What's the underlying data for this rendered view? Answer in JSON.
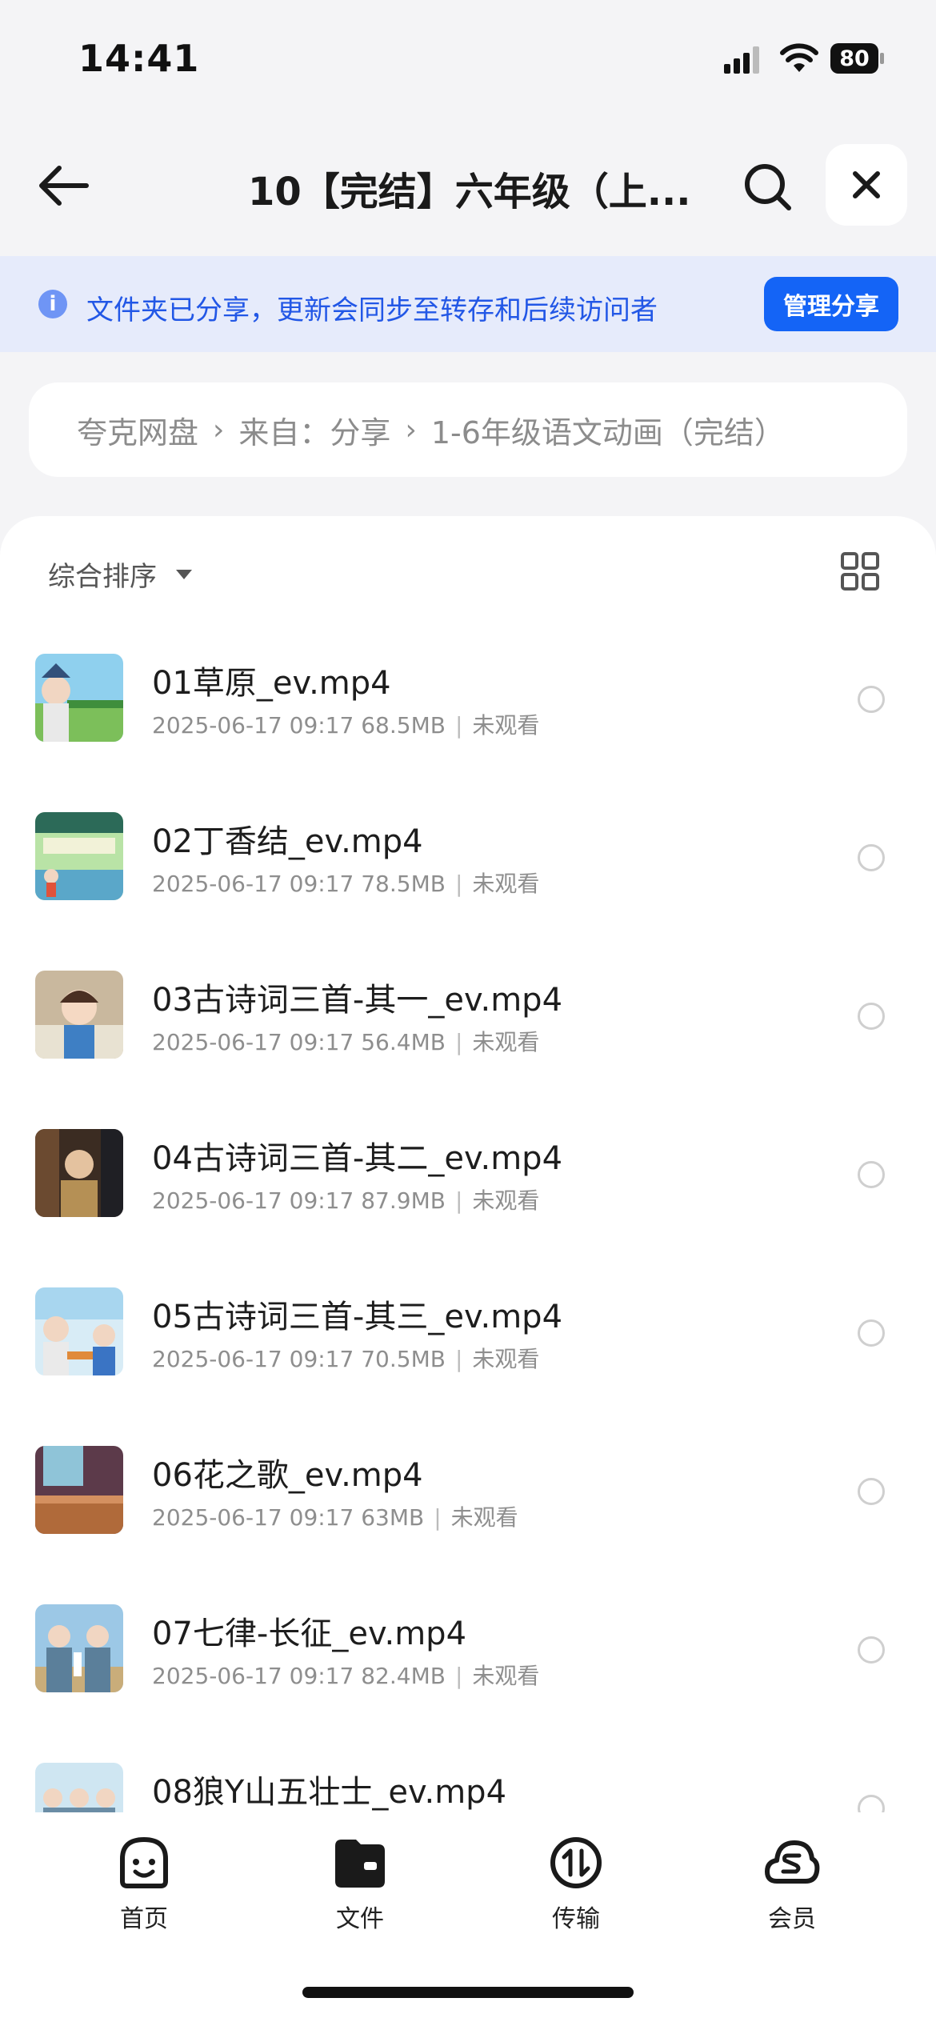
{
  "status_bar": {
    "time": "14:41",
    "battery": "80"
  },
  "nav": {
    "title": "10【完结】六年级（上..."
  },
  "banner": {
    "text": "文件夹已分享，更新会同步至转存和后续访问者",
    "button": "管理分享",
    "info_glyph": "i"
  },
  "breadcrumb": [
    "夸克网盘",
    "来自：分享",
    "1-6年级语文动画（完结）"
  ],
  "sort": {
    "label": "综合排序"
  },
  "files": [
    {
      "name": "01草原_ev.mp4",
      "date": "2025-06-17 09:17",
      "size": "68.5MB",
      "status": "未观看"
    },
    {
      "name": "02丁香结_ev.mp4",
      "date": "2025-06-17 09:17",
      "size": "78.5MB",
      "status": "未观看"
    },
    {
      "name": "03古诗词三首-其一_ev.mp4",
      "date": "2025-06-17 09:17",
      "size": "56.4MB",
      "status": "未观看"
    },
    {
      "name": "04古诗词三首-其二_ev.mp4",
      "date": "2025-06-17 09:17",
      "size": "87.9MB",
      "status": "未观看"
    },
    {
      "name": "05古诗词三首-其三_ev.mp4",
      "date": "2025-06-17 09:17",
      "size": "70.5MB",
      "status": "未观看"
    },
    {
      "name": "06花之歌_ev.mp4",
      "date": "2025-06-17 09:17",
      "size": "63MB",
      "status": "未观看"
    },
    {
      "name": "07七律-长征_ev.mp4",
      "date": "2025-06-17 09:17",
      "size": "82.4MB",
      "status": "未观看"
    },
    {
      "name": "08狼Y山五壮士_ev.mp4",
      "date": "",
      "size": "",
      "status": ""
    }
  ],
  "tabs": [
    {
      "label": "首页",
      "icon": "smile-home-icon"
    },
    {
      "label": "文件",
      "icon": "folder-icon"
    },
    {
      "label": "传输",
      "icon": "transfer-icon"
    },
    {
      "label": "会员",
      "icon": "membership-cloud-icon"
    }
  ],
  "colors": {
    "accent": "#1464f6",
    "banner_bg": "#e6ebfb",
    "banner_text": "#2257e6"
  }
}
